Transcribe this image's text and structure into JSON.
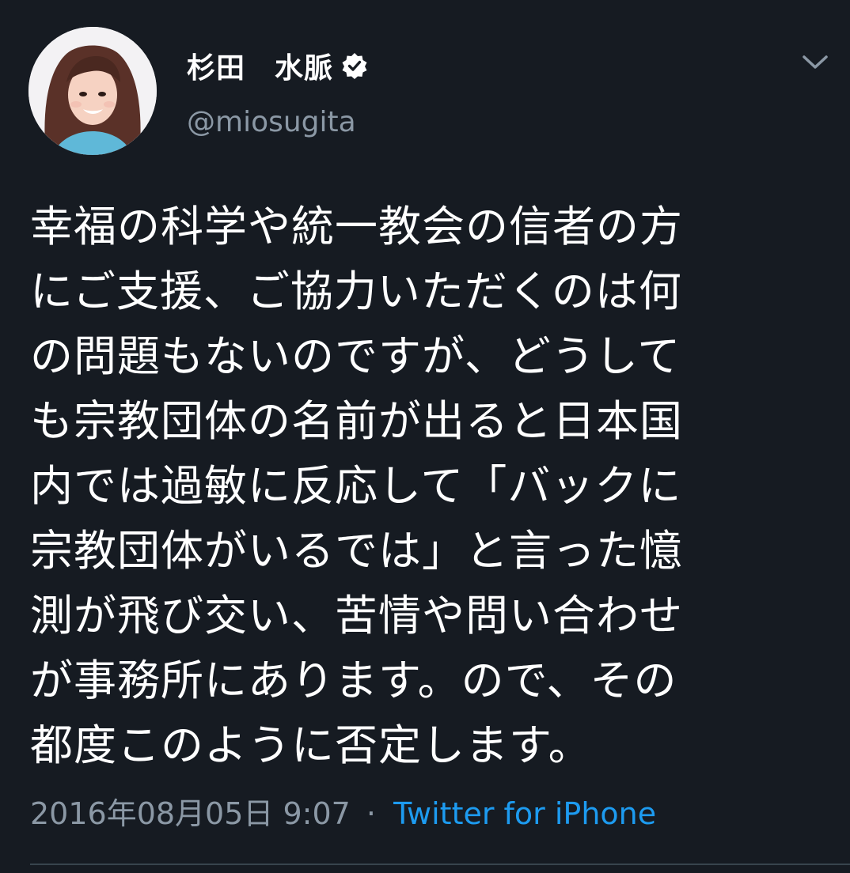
{
  "tweet": {
    "author": {
      "display_name": "杉田　水脈",
      "handle": "@miosugita",
      "verified": true,
      "avatar_icon": "profile-photo"
    },
    "body_lines": [
      "幸福の科学や統一教会の信者の方",
      "にご支援、ご協力いただくのは何",
      "の問題もないのですが、どうして",
      "も宗教団体の名前が出ると日本国",
      "内では過敏に反応して「バックに",
      "宗教団体がいるでは」と言った憶",
      "測が飛び交い、苦情や問い合わせ",
      "が事務所にあります。ので、その",
      "都度このように否定します。"
    ],
    "timestamp": "2016年08月05日 9:07",
    "separator": "·",
    "source": "Twitter for iPhone",
    "menu_icon": "chevron-down-icon"
  },
  "colors": {
    "background": "#161b22",
    "text": "#ffffff",
    "secondary_text": "#8b98a5",
    "link": "#1d9bf0",
    "divider": "#38444d"
  }
}
